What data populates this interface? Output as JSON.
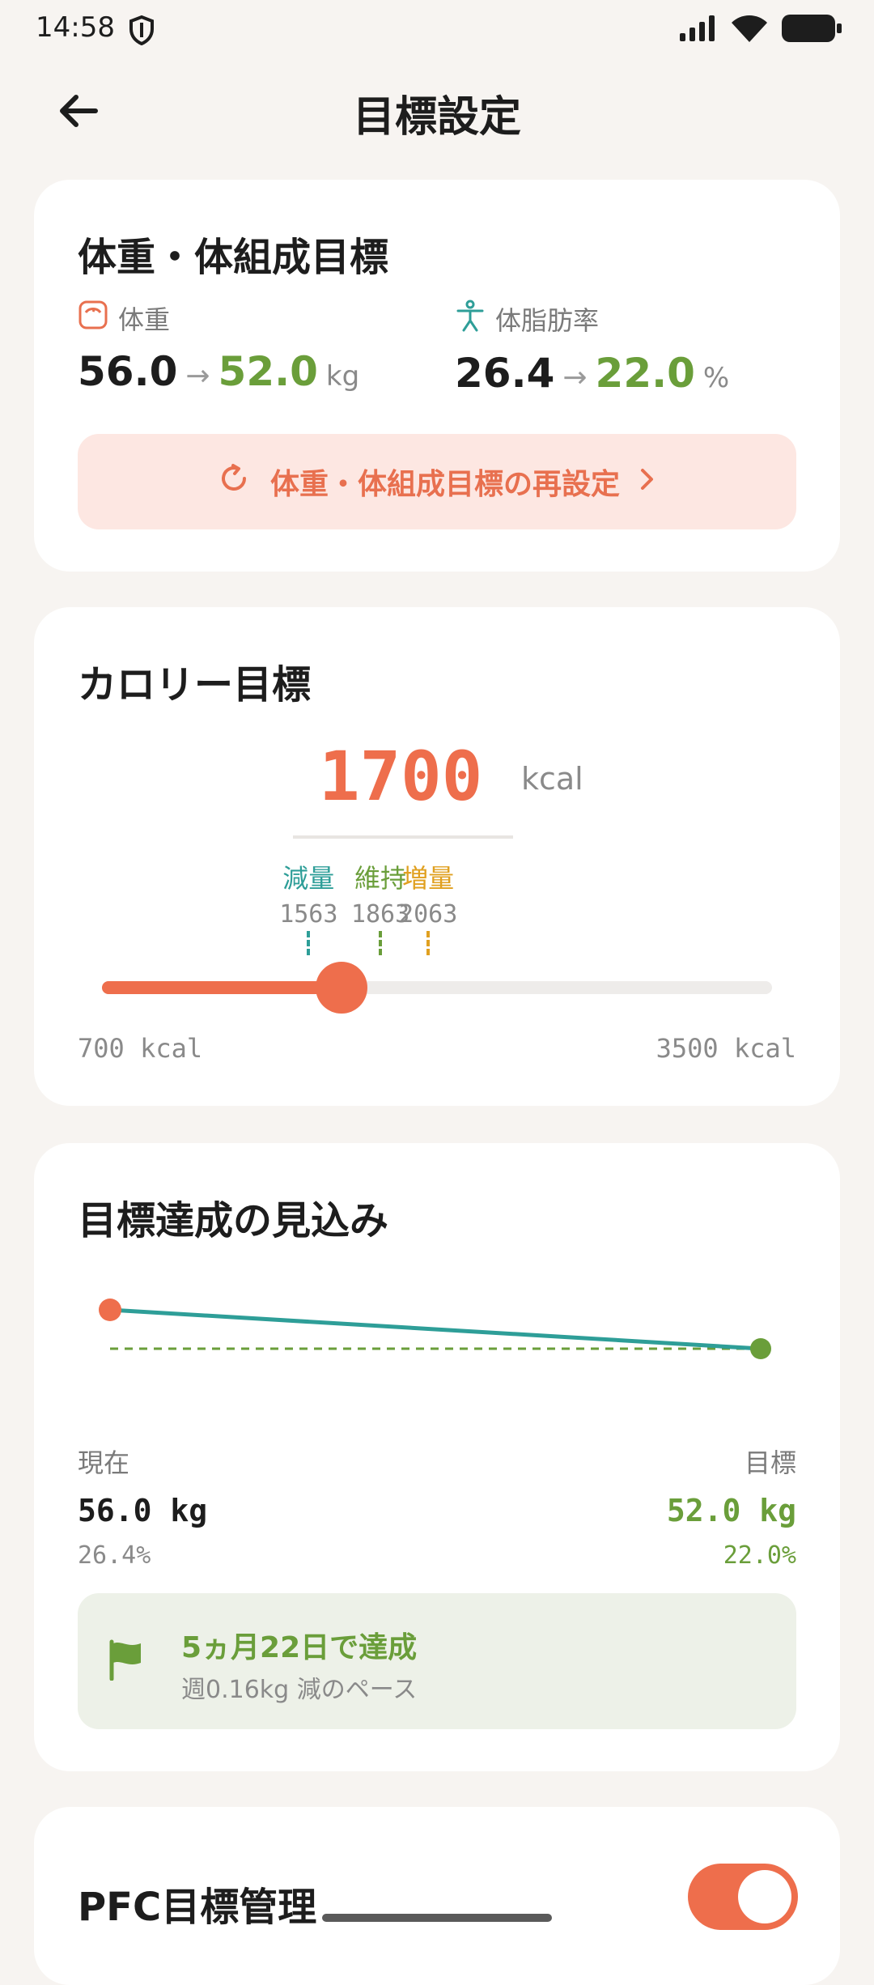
{
  "status_bar": {
    "time": "14:58"
  },
  "header": {
    "title": "目標設定"
  },
  "body_goal": {
    "title": "体重・体組成目標",
    "weight": {
      "label": "体重",
      "current": "56.0",
      "target": "52.0",
      "unit": "kg"
    },
    "body_fat": {
      "label": "体脂肪率",
      "current": "26.4",
      "target": "22.0",
      "unit": "%"
    },
    "reset_label": "体重・体組成目標の再設定"
  },
  "calorie_goal": {
    "title": "カロリー目標",
    "value": "1700",
    "unit": "kcal",
    "markers": [
      {
        "label": "減量",
        "value": "1563",
        "color": "#2E9E98"
      },
      {
        "label": "維持",
        "value": "1863",
        "color": "#6A9E3A"
      },
      {
        "label": "増量",
        "value": "2063",
        "color": "#E0A020"
      }
    ],
    "slider": {
      "min": 700,
      "max": 3500,
      "value": 1700
    },
    "min_label": "700 kcal",
    "max_label": "3500 kcal"
  },
  "projection": {
    "title": "目標達成の見込み",
    "current": {
      "label": "現在",
      "weight": "56.0 kg",
      "body_fat": "26.4%"
    },
    "target": {
      "label": "目標",
      "weight": "52.0 kg",
      "body_fat": "22.0%"
    },
    "achieve_title": "5ヵ月22日で達成",
    "achieve_sub": "週0.16kg 減のペース"
  },
  "pfc": {
    "title": "PFC目標管理",
    "enabled": true
  },
  "colors": {
    "accent": "#EE6E4C",
    "green": "#6A9E3A",
    "teal": "#2E9E98",
    "amber": "#E0A020"
  }
}
